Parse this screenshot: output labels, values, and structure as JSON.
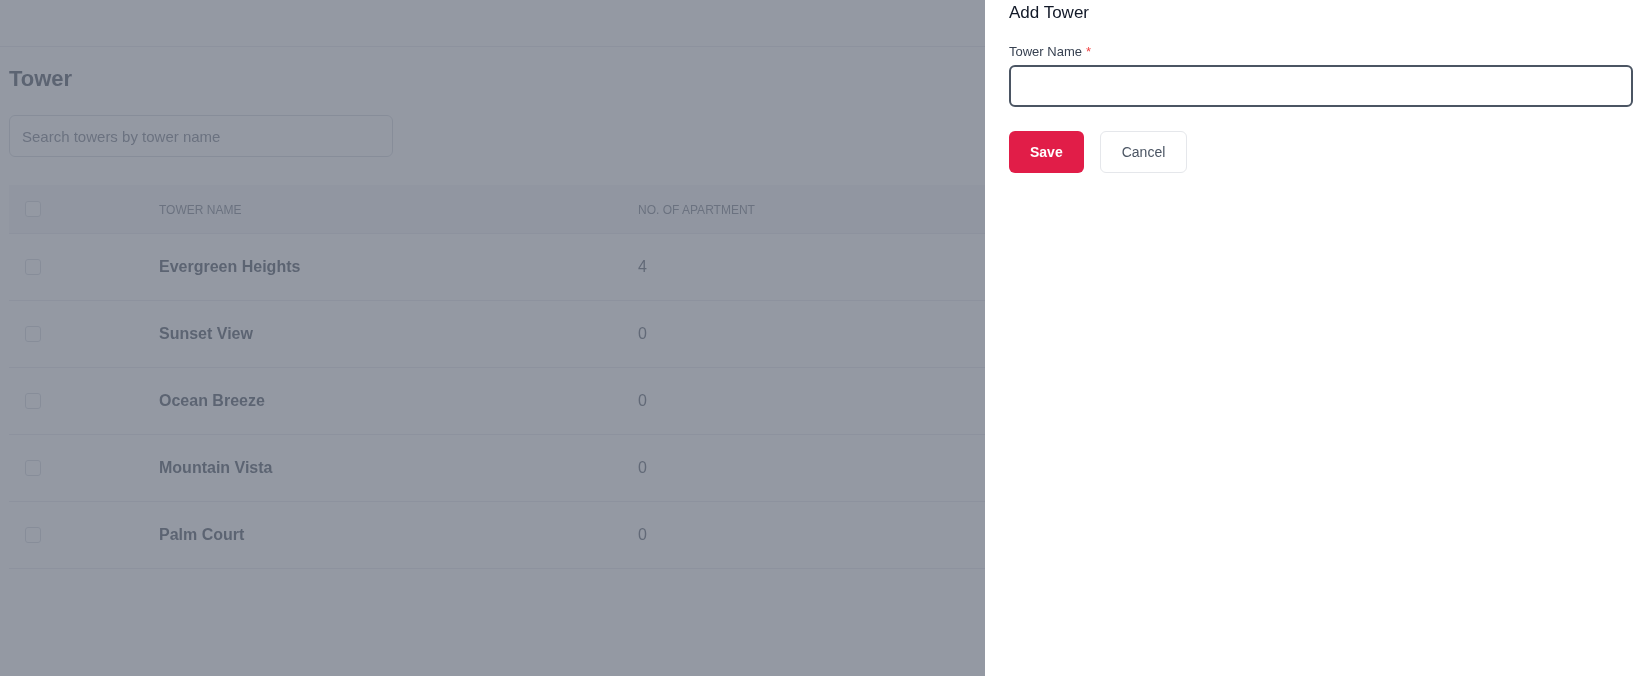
{
  "page": {
    "title": "Tower",
    "search": {
      "placeholder": "Search towers by tower name"
    }
  },
  "table": {
    "select_all": {
      "checked": false
    },
    "columns": [
      "TOWER NAME",
      "NO. OF APARTMENT"
    ],
    "rows": [
      {
        "checked": false,
        "cells": [
          "Evergreen Heights",
          "4"
        ]
      },
      {
        "checked": false,
        "cells": [
          "Sunset View",
          "0"
        ]
      },
      {
        "checked": false,
        "cells": [
          "Ocean Breeze",
          "0"
        ]
      },
      {
        "checked": false,
        "cells": [
          "Mountain Vista",
          "0"
        ]
      },
      {
        "checked": false,
        "cells": [
          "Palm Court",
          "0"
        ]
      }
    ]
  },
  "drawer": {
    "title": "Add Tower",
    "field": {
      "label": "Tower Name",
      "required_mark": "*"
    },
    "buttons": [
      {
        "kind": "primary",
        "label": "Save"
      },
      {
        "kind": "secondary",
        "label": "Cancel"
      }
    ]
  }
}
